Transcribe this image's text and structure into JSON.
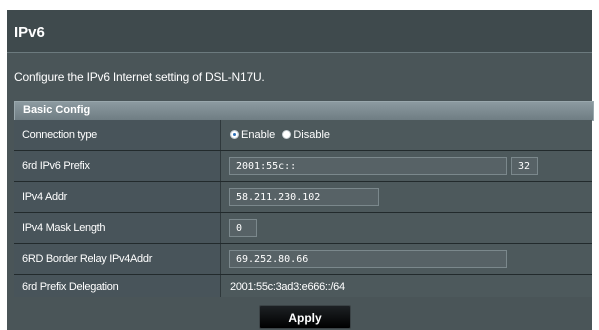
{
  "title": "IPv6",
  "description": "Configure the IPv6 Internet setting of DSL-N17U.",
  "section": "Basic Config",
  "rows": {
    "connection_type": {
      "label": "Connection type",
      "options": [
        "Enable",
        "Disable"
      ],
      "selected": "Enable"
    },
    "prefix": {
      "label": "6rd IPv6 Prefix",
      "value": "2001:55c::",
      "length": "32"
    },
    "ipv4_addr": {
      "label": "IPv4 Addr",
      "value": "58.211.230.102"
    },
    "mask_length": {
      "label": "IPv4 Mask Length",
      "value": "0"
    },
    "border_relay": {
      "label": "6RD Border Relay IPv4Addr",
      "value": "69.252.80.66"
    },
    "delegation": {
      "label": "6rd Prefix Delegation",
      "value": "2001:55c:3ad3:e666::/64"
    }
  },
  "apply_label": "Apply",
  "colors": {
    "panel": "#4a5558",
    "header": "#8c9aa0",
    "button": "#000000"
  }
}
